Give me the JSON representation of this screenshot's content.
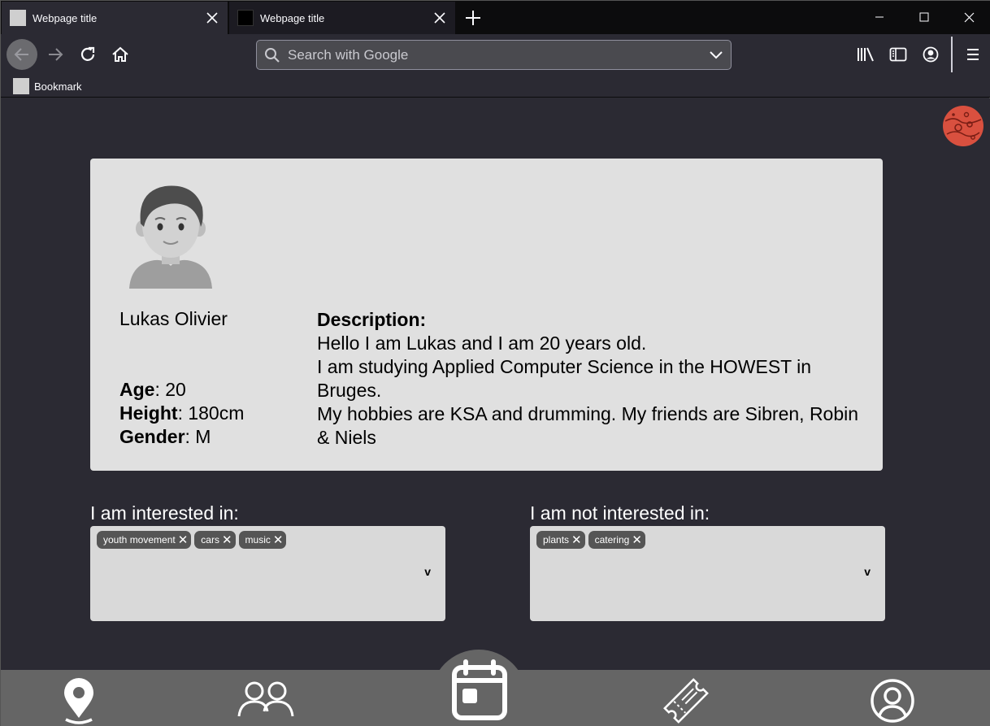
{
  "browser": {
    "tabs": [
      {
        "title": "Webpage title"
      },
      {
        "title": "Webpage title"
      }
    ],
    "url_placeholder": "Search with Google",
    "bookmark_label": "Bookmark"
  },
  "profile": {
    "name": "Lukas Olivier",
    "age_label": "Age",
    "age_value": ": 20",
    "height_label": "Height",
    "height_value": ": 180cm",
    "gender_label": "Gender",
    "gender_value": ": M",
    "description_title": "Description:",
    "description_lines": [
      "Hello I am Lukas and I am 20 years old.",
      "I am studying Applied Computer Science in the HOWEST in Bruges.",
      "My hobbies are KSA and drumming. My friends are Sibren, Robin & Niels"
    ]
  },
  "interests": {
    "interested_label": "I am interested in:",
    "interested_tags": [
      "youth movement",
      "cars",
      "music"
    ],
    "not_interested_label": "I am not interested in:",
    "not_interested_tags": [
      "plants",
      "catering"
    ],
    "dropdown_arrow": "v"
  },
  "colors": {
    "card_bg": "#e0e0e0",
    "chip_bg": "#555555",
    "nav_bg": "#656565",
    "logo_red": "#d9503f"
  }
}
